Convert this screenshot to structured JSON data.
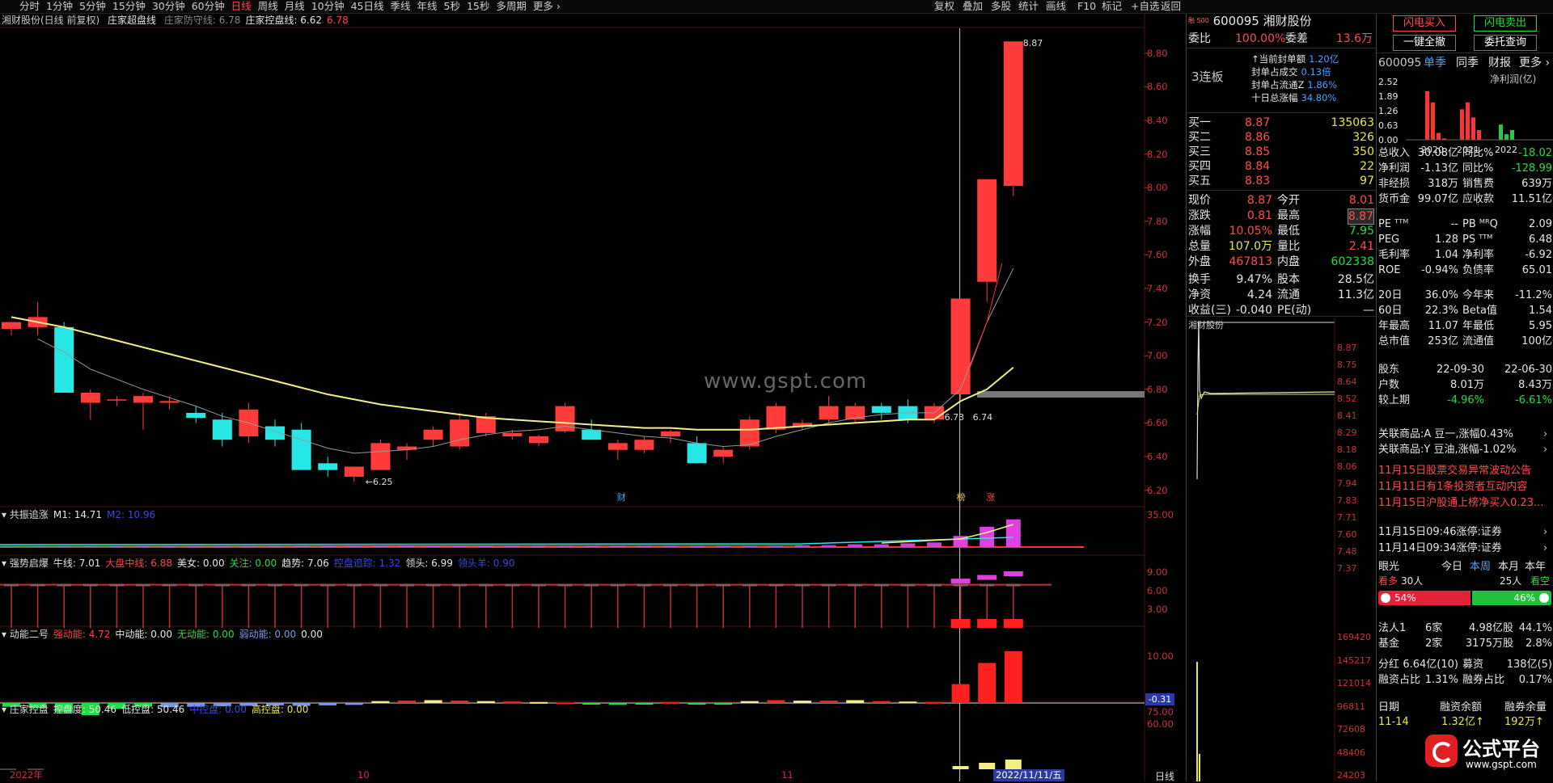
{
  "toolbar": {
    "periods": [
      "分时",
      "1分钟",
      "5分钟",
      "15分钟",
      "30分钟",
      "60分钟",
      "日线",
      "周线",
      "月线",
      "10分钟",
      "45日线",
      "季线",
      "年线",
      "5秒",
      "15秒",
      "多周期",
      "更多 ›"
    ],
    "active_period": "日线",
    "tools": [
      "复权",
      "叠加",
      "多股",
      "统计",
      "画线",
      "F10",
      "标记",
      "+自选",
      "返回"
    ]
  },
  "main_chart": {
    "title": "湘财股份(日线 前复权)",
    "indicator_name": "庄家超盘线",
    "indicator_items": [
      {
        "label": "庄家防守线: 6.78",
        "color": "#888888"
      },
      {
        "label": "庄家控盘线: 6.62",
        "color": "#e6e6e6"
      },
      {
        "label": "6.78",
        "color": "#ff4444"
      }
    ],
    "y_ticks": [
      "8.80",
      "8.60",
      "8.40",
      "8.20",
      "8.00",
      "7.80",
      "7.60",
      "7.40",
      "7.20",
      "7.00",
      "6.80",
      "6.60",
      "6.40",
      "6.20"
    ],
    "watermark": "www.gspt.com",
    "annot_high": "8.87",
    "annot_low": "6.25",
    "annot_mid1": "6.73",
    "annot_mid2": "6.74",
    "markers": [
      {
        "text": "财",
        "color": "#4aa3ff"
      },
      {
        "text": "榜",
        "color": "#e8c040"
      },
      {
        "text": "涨",
        "color": "#ff5050"
      }
    ],
    "x_labels": [
      "2022年",
      "10",
      "11",
      "2022/11/11/五"
    ],
    "period_label": "日线"
  },
  "chart_data": {
    "type": "candlestick",
    "ylim": [
      6.15,
      8.9
    ],
    "candles": [
      {
        "o": 7.16,
        "h": 7.2,
        "l": 7.12,
        "c": 7.2
      },
      {
        "o": 7.17,
        "h": 7.32,
        "l": 7.12,
        "c": 7.23
      },
      {
        "o": 7.17,
        "h": 7.2,
        "l": 6.78,
        "c": 6.78
      },
      {
        "o": 6.72,
        "h": 6.8,
        "l": 6.62,
        "c": 6.78
      },
      {
        "o": 6.74,
        "h": 6.76,
        "l": 6.7,
        "c": 6.74
      },
      {
        "o": 6.72,
        "h": 6.78,
        "l": 6.56,
        "c": 6.76
      },
      {
        "o": 6.72,
        "h": 6.76,
        "l": 6.68,
        "c": 6.73
      },
      {
        "o": 6.66,
        "h": 6.7,
        "l": 6.6,
        "c": 6.63
      },
      {
        "o": 6.62,
        "h": 6.66,
        "l": 6.46,
        "c": 6.5
      },
      {
        "o": 6.52,
        "h": 6.72,
        "l": 6.48,
        "c": 6.68
      },
      {
        "o": 6.58,
        "h": 6.62,
        "l": 6.46,
        "c": 6.5
      },
      {
        "o": 6.56,
        "h": 6.6,
        "l": 6.32,
        "c": 6.32
      },
      {
        "o": 6.36,
        "h": 6.4,
        "l": 6.28,
        "c": 6.32
      },
      {
        "o": 6.28,
        "h": 6.34,
        "l": 6.25,
        "c": 6.34
      },
      {
        "o": 6.32,
        "h": 6.5,
        "l": 6.32,
        "c": 6.48
      },
      {
        "o": 6.44,
        "h": 6.48,
        "l": 6.38,
        "c": 6.46
      },
      {
        "o": 6.5,
        "h": 6.58,
        "l": 6.46,
        "c": 6.56
      },
      {
        "o": 6.46,
        "h": 6.66,
        "l": 6.44,
        "c": 6.62
      },
      {
        "o": 6.54,
        "h": 6.66,
        "l": 6.52,
        "c": 6.64
      },
      {
        "o": 6.52,
        "h": 6.56,
        "l": 6.5,
        "c": 6.54
      },
      {
        "o": 6.48,
        "h": 6.53,
        "l": 6.46,
        "c": 6.52
      },
      {
        "o": 6.55,
        "h": 6.72,
        "l": 6.54,
        "c": 6.7
      },
      {
        "o": 6.56,
        "h": 6.62,
        "l": 6.5,
        "c": 6.5
      },
      {
        "o": 6.44,
        "h": 6.5,
        "l": 6.38,
        "c": 6.48
      },
      {
        "o": 6.44,
        "h": 6.52,
        "l": 6.42,
        "c": 6.5
      },
      {
        "o": 6.52,
        "h": 6.56,
        "l": 6.48,
        "c": 6.55
      },
      {
        "o": 6.48,
        "h": 6.52,
        "l": 6.36,
        "c": 6.36
      },
      {
        "o": 6.4,
        "h": 6.46,
        "l": 6.36,
        "c": 6.44
      },
      {
        "o": 6.46,
        "h": 6.64,
        "l": 6.44,
        "c": 6.62
      },
      {
        "o": 6.56,
        "h": 6.72,
        "l": 6.54,
        "c": 6.7
      },
      {
        "o": 6.58,
        "h": 6.62,
        "l": 6.56,
        "c": 6.6
      },
      {
        "o": 6.62,
        "h": 6.76,
        "l": 6.6,
        "c": 6.7
      },
      {
        "o": 6.62,
        "h": 6.72,
        "l": 6.6,
        "c": 6.7
      },
      {
        "o": 6.7,
        "h": 6.72,
        "l": 6.62,
        "c": 6.66
      },
      {
        "o": 6.7,
        "h": 6.74,
        "l": 6.6,
        "c": 6.62
      },
      {
        "o": 6.62,
        "h": 6.72,
        "l": 6.6,
        "c": 6.7
      },
      {
        "o": 6.77,
        "h": 7.34,
        "l": 6.74,
        "c": 7.34
      },
      {
        "o": 7.44,
        "h": 8.05,
        "l": 7.32,
        "c": 8.05
      },
      {
        "o": 8.01,
        "h": 8.87,
        "l": 7.95,
        "c": 8.87
      }
    ],
    "ma_yellow": [
      7.23,
      7.2,
      7.17,
      7.13,
      7.09,
      7.05,
      7.01,
      6.97,
      6.93,
      6.89,
      6.85,
      6.81,
      6.77,
      6.74,
      6.71,
      6.69,
      6.67,
      6.65,
      6.63,
      6.62,
      6.61,
      6.6,
      6.59,
      6.58,
      6.57,
      6.57,
      6.56,
      6.56,
      6.56,
      6.57,
      6.58,
      6.59,
      6.6,
      6.61,
      6.62,
      6.62,
      6.73,
      6.8,
      6.93
    ],
    "ma_grey": [
      null,
      7.1,
      7.02,
      6.92,
      6.86,
      6.8,
      6.75,
      6.7,
      6.64,
      6.6,
      6.55,
      6.5,
      6.45,
      6.42,
      6.43,
      6.44,
      6.46,
      6.5,
      6.53,
      6.55,
      6.56,
      6.58,
      6.56,
      6.54,
      6.52,
      6.51,
      6.48,
      6.46,
      6.47,
      6.52,
      6.56,
      6.6,
      6.63,
      6.65,
      6.66,
      6.66,
      6.8,
      7.2,
      7.52
    ]
  },
  "panels": [
    {
      "name": "共振追涨",
      "items": [
        {
          "label": "M1: 14.71",
          "color": "#e6e6e6"
        },
        {
          "label": "M2: 10.96",
          "color": "#3a4ad8"
        }
      ],
      "ticks": [
        "35.00"
      ],
      "values": [
        1,
        1,
        1,
        1,
        1,
        1,
        1,
        1,
        1,
        1,
        1,
        1,
        1,
        1,
        1,
        1,
        1,
        1,
        1,
        1,
        1,
        1,
        1,
        1,
        1,
        1,
        1,
        1,
        1,
        1,
        2,
        2,
        3,
        3,
        4,
        5,
        12,
        22,
        30
      ]
    },
    {
      "name": "强势启爆",
      "items": [
        {
          "label": "牛线: 7.01",
          "color": "#e6e6e6"
        },
        {
          "label": "大盘中线: 6.88",
          "color": "#ff4444"
        },
        {
          "label": "美女: 0.00",
          "color": "#e6e6e6"
        },
        {
          "label": "关注: 0.00",
          "color": "#22dd44"
        },
        {
          "label": "趋势: 7.06",
          "color": "#e6e6e6"
        },
        {
          "label": "控盘追踪: 1.32",
          "color": "#3a4ad8"
        },
        {
          "label": "领头: 6.99",
          "color": "#e6e6e6"
        },
        {
          "label": "领头羊: 0.90",
          "color": "#3a4ad8"
        }
      ],
      "ticks": [
        "9.00",
        "6.00",
        "3.00"
      ]
    },
    {
      "name": "动能二号",
      "items": [
        {
          "label": "强动能: 4.72",
          "color": "#ff4444"
        },
        {
          "label": "中动能: 0.00",
          "color": "#e6e6e6"
        },
        {
          "label": "无动能: 0.00",
          "color": "#22dd44"
        },
        {
          "label": "弱动能: 0.00",
          "color": "#7a9ae8"
        },
        {
          "label": "0.00",
          "color": "#e6e6e6"
        }
      ],
      "ticks": [
        "10.00"
      ],
      "tag": "-0.31",
      "values": [
        -0.8,
        -1.1,
        -2.0,
        -2.6,
        -1.2,
        -0.8,
        -0.9,
        -0.8,
        -0.7,
        -0.6,
        -0.5,
        -0.6,
        -0.5,
        -0.4,
        0.4,
        0.5,
        0.6,
        0.5,
        0.4,
        0.3,
        0.2,
        0.1,
        -0.3,
        -0.4,
        -0.3,
        0.2,
        -0.3,
        -0.2,
        0.4,
        0.6,
        0.5,
        0.5,
        0.6,
        0.4,
        0.3,
        0.2,
        4.0,
        8.5,
        11.0
      ]
    },
    {
      "name": "庄家控盘",
      "items": [
        {
          "label": "控盘度: 50.46",
          "color": "#e6e6e6"
        },
        {
          "label": "低控盘: 50.46",
          "color": "#e6e6e6"
        },
        {
          "label": "中控盘: 0.00",
          "color": "#3a4ad8"
        },
        {
          "label": "高控盘: 0.00",
          "color": "#e8e84a"
        }
      ],
      "ticks": [
        "75.00",
        "60.00"
      ]
    }
  ],
  "quote": {
    "code": "600095",
    "name": "湘财股份",
    "exchange_tag": "融 500",
    "webi_label": "委比",
    "webi": "100.00%",
    "weicha_label": "委差",
    "weicha": "13.6万",
    "limit_label": "3连板",
    "seal_info": [
      {
        "label": "↑当前封单额",
        "value": "1.20亿"
      },
      {
        "label": "封单占成交",
        "value": "0.13倍"
      },
      {
        "label": "封单占流通Z",
        "value": "1.86%"
      },
      {
        "label": "十日总涨幅",
        "value": "34.80%"
      }
    ],
    "bids": [
      {
        "label": "买一",
        "price": "8.87",
        "vol": "135063"
      },
      {
        "label": "买二",
        "price": "8.86",
        "vol": "326"
      },
      {
        "label": "买三",
        "price": "8.85",
        "vol": "350"
      },
      {
        "label": "买四",
        "price": "8.84",
        "vol": "22"
      },
      {
        "label": "买五",
        "price": "8.83",
        "vol": "97"
      }
    ],
    "stats": [
      {
        "l1": "现价",
        "v1": "8.87",
        "l2": "今开",
        "v2": "8.01"
      },
      {
        "l1": "涨跌",
        "v1": "0.81",
        "l2": "最高",
        "v2": "8.87"
      },
      {
        "l1": "涨幅",
        "v1": "10.05%",
        "l2": "最低",
        "v2": "7.95"
      },
      {
        "l1": "总量",
        "v1": "107.0万",
        "l2": "量比",
        "v2": "2.41"
      },
      {
        "l1": "外盘",
        "v1": "467813",
        "l2": "内盘",
        "v2": "602338"
      },
      {
        "l1": "换手",
        "v1": "9.47%",
        "l2": "股本",
        "v2": "28.5亿"
      },
      {
        "l1": "净资",
        "v1": "4.24",
        "l2": "流通",
        "v2": "11.3亿"
      },
      {
        "l1": "收益(三)",
        "v1": "-0.040",
        "l2": "PE(动)",
        "v2": "—"
      }
    ],
    "mini_title": "湘财股份",
    "mini_ticks": [
      "8.87",
      "8.75",
      "8.64",
      "8.52",
      "8.41",
      "8.29",
      "8.18",
      "8.06",
      "7.94",
      "7.83",
      "7.71",
      "7.60",
      "7.48",
      "7.37"
    ],
    "mini_vol_ticks": [
      "169420",
      "145217",
      "121014",
      "96811",
      "72608",
      "48406",
      "24203"
    ]
  },
  "right": {
    "btn_flash_buy": "闪电买入",
    "btn_flash_sell": "闪电卖出",
    "btn_cancel_all": "一键全撤",
    "btn_query": "委托查询",
    "code": "600095",
    "tabs": [
      "单季",
      "同季",
      "财报",
      "更多 ›"
    ],
    "fin_label": "净利润(亿)",
    "fin_ticks": [
      "2.52",
      "1.89",
      "1.26",
      "0.63",
      "0.00"
    ],
    "fin_years": [
      "2020",
      "2021",
      "2022"
    ],
    "fin_bars": [
      {
        "v": 2.1,
        "c": "#ff3333"
      },
      {
        "v": 1.62,
        "c": "#ff3333"
      },
      {
        "v": 0.3,
        "c": "#ff3333"
      },
      {
        "v": 0.06,
        "c": "#ff3333"
      },
      {
        "v": 1.32,
        "c": "#ff3333"
      },
      {
        "v": 1.62,
        "c": "#ff3333"
      },
      {
        "v": 0.97,
        "c": "#ff3333"
      },
      {
        "v": 0.42,
        "c": "#ff3333"
      },
      {
        "v": 0.66,
        "c": "#22cc44"
      },
      {
        "v": 0.24,
        "c": "#22cc44"
      },
      {
        "v": 0.42,
        "c": "#22cc44"
      }
    ],
    "fin_rows": [
      {
        "l1": "总收入",
        "v1": "30.08亿",
        "l2": "同比%",
        "v2": "-18.02",
        "c": "#22dd44"
      },
      {
        "l1": "净利润",
        "v1": "-1.13亿",
        "l2": "同比%",
        "v2": "-128.99",
        "c": "#22dd44"
      },
      {
        "l1": "非经损",
        "v1": "318万",
        "l2": "销售费",
        "v2": "639万",
        "c": "#e6e6e6"
      },
      {
        "l1": "货币金",
        "v1": "99.07亿",
        "l2": "应收款",
        "v2": "11.51亿",
        "c": "#e6e6e6"
      }
    ],
    "val_rows": [
      {
        "l1": "PE ᵀᵀᴹ",
        "v1": "--",
        "l2": "PB ᴹᴿQ",
        "v2": "2.09"
      },
      {
        "l1": "PEG",
        "v1": "1.28",
        "l2": "PS ᵀᵀᴹ",
        "v2": "6.48"
      },
      {
        "l1": "毛利率",
        "v1": "1.04",
        "l2": "净利率",
        "v2": "-6.92"
      },
      {
        "l1": "ROE",
        "v1": "-0.94%",
        "l2": "负债率",
        "v2": "65.01"
      }
    ],
    "perf_rows": [
      {
        "l1": "20日",
        "v1": "36.0%",
        "l2": "今年来",
        "v2": "-11.2%"
      },
      {
        "l1": "60日",
        "v1": "22.3%",
        "l2": "Beta值",
        "v2": "1.54"
      },
      {
        "l1": "年最高",
        "v1": "11.07",
        "l2": "年最低",
        "v2": "5.95"
      },
      {
        "l1": "总市值",
        "v1": "253亿",
        "l2": "流通值",
        "v2": "100亿"
      }
    ],
    "holder_rows": [
      {
        "l1": "股东",
        "v1": "22-09-30",
        "v2": "22-06-30"
      },
      {
        "l1": "户数",
        "v1": "8.01万",
        "v2": "8.43万"
      },
      {
        "l1": "较上期",
        "v1": "-4.96%",
        "v2": "-6.61%"
      }
    ],
    "related": [
      {
        "text": "关联商品:A 豆一,涨幅0.43%",
        "c": "#ff4d4d"
      },
      {
        "text": "关联商品:Y 豆油,涨幅-1.02%",
        "c": "#22dd44"
      }
    ],
    "news": [
      "11月15日股票交易异常波动公告",
      "11月11日有1条投资者互动内容",
      "11月15日沪股通上榜净买入0.23..."
    ],
    "alerts": [
      "11月15日09:46涨停:证券",
      "11月14日09:34涨停:证券"
    ],
    "eye_title": "眼光",
    "eye_tabs": [
      "今日",
      "本周",
      "本月",
      "本年"
    ],
    "bull_label": "看多",
    "bull_count": "30人",
    "bear_count": "25人",
    "bear_label": "看空",
    "bull_pct": "54%",
    "bear_pct": "46%",
    "bull_frac": 0.54,
    "inst_rows": [
      {
        "l": "法人1",
        "n": "6家",
        "a": "4.98亿股",
        "p": "44.1%"
      },
      {
        "l": "基金",
        "n": "2家",
        "a": "3175万股",
        "p": "2.8%"
      }
    ],
    "fund_rows": [
      {
        "l1": "分红",
        "v1": "6.64亿(10)",
        "l2": "募资",
        "v2": "138亿(5)"
      },
      {
        "l1": "融资占比",
        "v1": "1.31%",
        "l2": "融券占比",
        "v2": "0.17%"
      }
    ],
    "margin_header": [
      "日期",
      "融资余额",
      "融券余量"
    ],
    "margin_row": {
      "d": "11-14",
      "a": "1.32亿↑",
      "b": "192万↑"
    },
    "logo_text": "公式平台",
    "logo_url": "www.gspt.com"
  }
}
